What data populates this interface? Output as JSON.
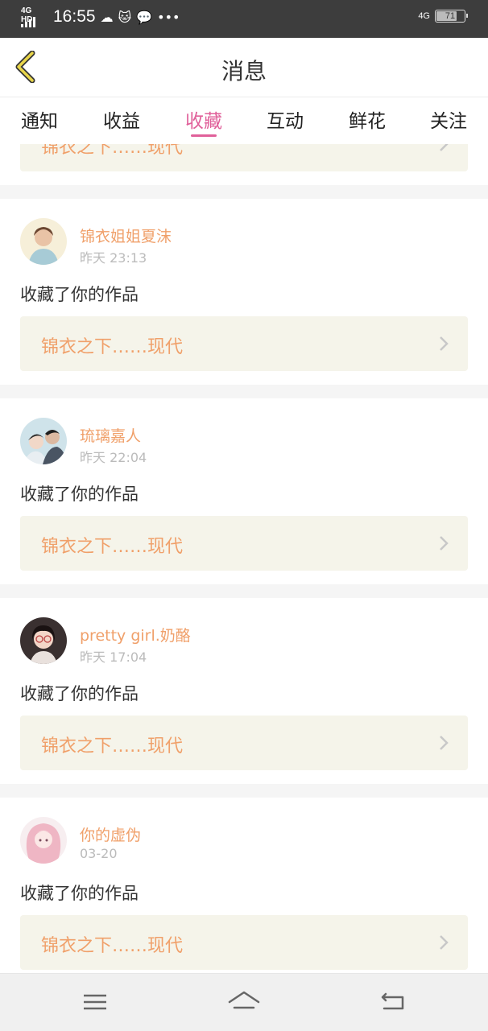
{
  "status_bar": {
    "network": "4G HD",
    "time": "16:55",
    "icons": [
      "cloud-icon",
      "cat-icon",
      "wechat-icon",
      "more-dots-icon"
    ],
    "right_network": "4G",
    "battery": "71"
  },
  "nav": {
    "title": "消息"
  },
  "tabs": [
    {
      "label": "通知"
    },
    {
      "label": "收益"
    },
    {
      "label": "收藏"
    },
    {
      "label": "互动"
    },
    {
      "label": "鲜花"
    },
    {
      "label": "关注"
    }
  ],
  "active_tab": "收藏",
  "colors": {
    "accent": "#e0609a",
    "username": "#f0a06a",
    "work_box": "#f5f4ea"
  },
  "partial_item": {
    "work_title": "锦衣之下……现代"
  },
  "items": [
    {
      "username": "锦衣姐姐夏沫",
      "time": "昨天 23:13",
      "action": "收藏了你的作品",
      "work_title": "锦衣之下……现代"
    },
    {
      "username": "琉璃嘉人",
      "time": "昨天 22:04",
      "action": "收藏了你的作品",
      "work_title": "锦衣之下……现代"
    },
    {
      "username": "pretty girl.奶酪",
      "time": "昨天 17:04",
      "action": "收藏了你的作品",
      "work_title": "锦衣之下……现代"
    },
    {
      "username": "你的虚伪",
      "time": "03-20",
      "action": "收藏了你的作品",
      "work_title": "锦衣之下……现代"
    }
  ],
  "bottom_nav": [
    "menu-icon",
    "home-icon",
    "back-icon"
  ]
}
